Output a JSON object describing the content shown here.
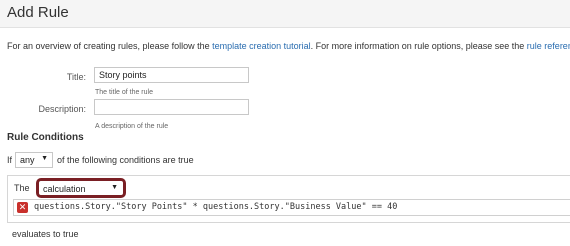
{
  "header": {
    "title": "Add Rule"
  },
  "intro": {
    "text_before": "For an overview of creating rules, please follow the ",
    "link1": "template creation tutorial",
    "text_middle": ". For more information on rule options, please see the ",
    "link2": "rule reference",
    "text_after": "."
  },
  "form": {
    "title_label": "Title:",
    "title_value": "Story points",
    "title_help": "The title of the rule",
    "description_label": "Description:",
    "description_value": "",
    "description_help": "A description of the rule"
  },
  "conditions": {
    "section_title": "Rule Conditions",
    "if_label": "If",
    "match_select": "any",
    "match_suffix": "of the following conditions are true",
    "the_label": "The",
    "type_select": "calculation",
    "expression": "questions.Story.\"Story Points\" * questions.Story.\"Business Value\" == 40",
    "error_icon": "x-error-icon",
    "result_text": "evaluates to true"
  },
  "colors": {
    "link": "#2a6db0",
    "highlight_border": "#7a1f24",
    "error": "#c9302c"
  }
}
